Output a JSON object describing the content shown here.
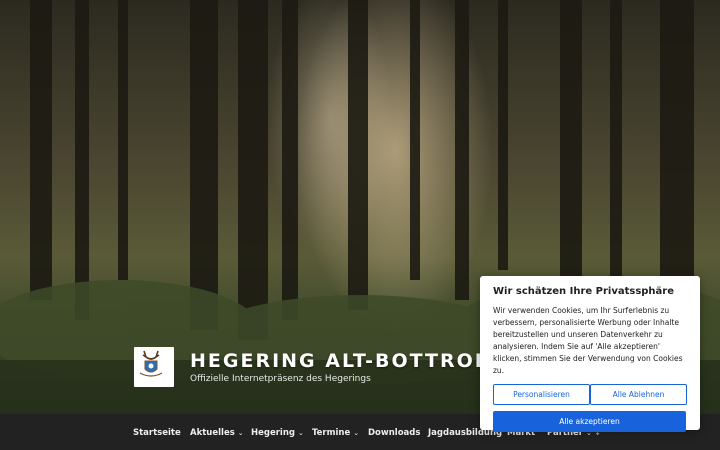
{
  "header": {
    "site_title": "HEGERING ALT-BOTTROP",
    "tagline": "Offizielle Internetpräsenz des Hegerings",
    "logo_icon": "deer-antler-crest-icon",
    "hero_image": "forest-sunrays-image"
  },
  "nav": {
    "items": [
      {
        "label": "Startseite",
        "dropdown": false
      },
      {
        "label": "Aktuelles",
        "dropdown": true
      },
      {
        "label": "Hegering",
        "dropdown": true
      },
      {
        "label": "Termine",
        "dropdown": true
      },
      {
        "label": "Downloads",
        "dropdown": false
      },
      {
        "label": "Jagdausbildung",
        "dropdown": false
      },
      {
        "label": "Markt",
        "dropdown": false
      },
      {
        "label": "Partner",
        "dropdown": true
      }
    ],
    "chevron": "⌄",
    "scroll_icon": "↓"
  },
  "cookie_banner": {
    "title": "Wir schätzen Ihre Privatssphäre",
    "text": "Wir verwenden Cookies, um Ihr Surferlebnis zu verbessern, personalisierte Werbung oder Inhalte bereitzustellen und unseren Datenverkehr zu analysieren. Indem Sie auf 'Alle akzeptieren' klicken, stimmen Sie der Verwendung von Cookies zu.",
    "customize_label": "Personalisieren",
    "reject_label": "Alle Ablehnen",
    "accept_label": "Alle akzeptieren"
  },
  "colors": {
    "accent": "#1863dc",
    "nav_background": "#222222"
  }
}
